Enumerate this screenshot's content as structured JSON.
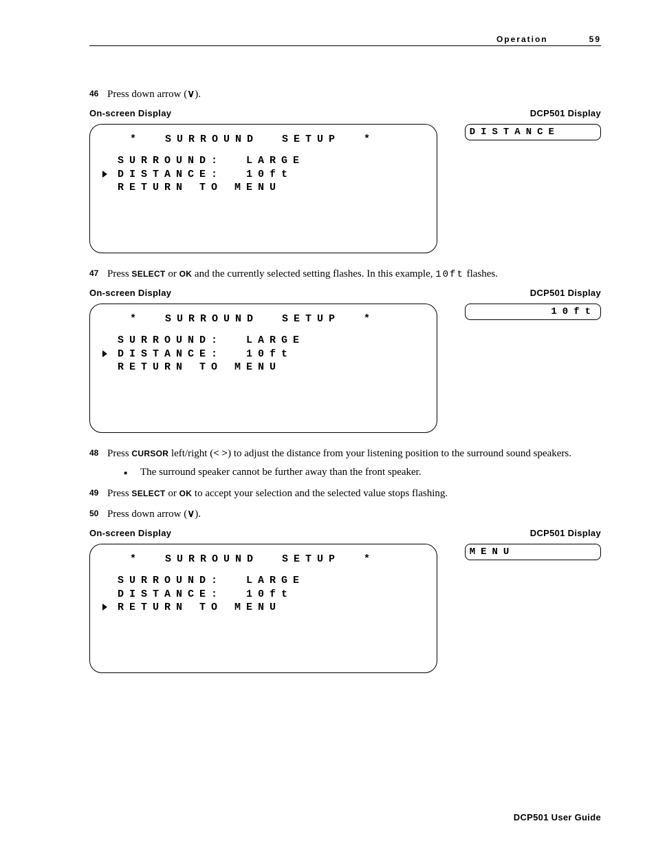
{
  "header": {
    "section": "Operation",
    "page": "59"
  },
  "labels": {
    "osd": "On-screen Display",
    "dcp": "DCP501 Display"
  },
  "step46": {
    "num": "46",
    "text_a": "Press down arrow (",
    "text_b": ")."
  },
  "step47": {
    "num": "47",
    "text_a": "Press ",
    "key1": "SELECT",
    "text_b": " or ",
    "key2": "OK",
    "text_c": " and the currently selected setting flashes. In this example, ",
    "val": "10ft",
    "text_d": " flashes."
  },
  "step48": {
    "num": "48",
    "text_a": "Press ",
    "key": "CURSOR",
    "text_b": " left/right (",
    "text_c": ") to adjust the distance from your listening position to the surround sound speakers."
  },
  "bullet48": "The surround speaker cannot be further away than the front speaker.",
  "step49": {
    "num": "49",
    "text_a": "Press ",
    "key1": "SELECT",
    "text_b": " or ",
    "key2": "OK",
    "text_c": " to accept your selection and the selected value stops flashing."
  },
  "step50": {
    "num": "50",
    "text_a": "Press down arrow (",
    "text_b": ")."
  },
  "osd": {
    "title": "*  SURROUND  SETUP  *",
    "l1": "SURROUND:  LARGE",
    "l2": "DISTANCE:  10ft",
    "l3": "RETURN TO MENU"
  },
  "dcp1": "DISTANCE",
  "dcp2": "10ft",
  "dcp3": "MENU",
  "footer": "DCP501 User Guide"
}
